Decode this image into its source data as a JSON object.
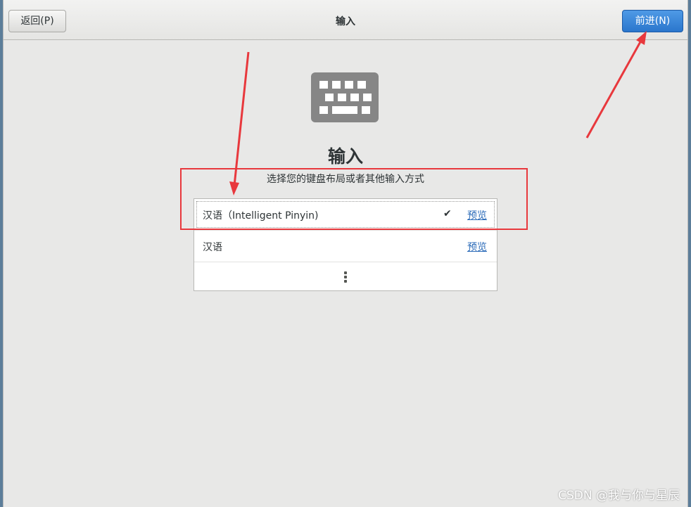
{
  "header": {
    "back_label": "返回(P)",
    "title": "输入",
    "next_label": "前进(N)"
  },
  "main": {
    "icon": "keyboard-icon",
    "title": "输入",
    "subtitle": "选择您的键盘布局或者其他输入方式",
    "sources": [
      {
        "label": "汉语（Intelligent Pinyin)",
        "selected": true,
        "preview_label": "预览"
      },
      {
        "label": "汉语",
        "selected": false,
        "preview_label": "预览"
      }
    ],
    "more_icon": "more-vertical-icon"
  },
  "watermark": "CSDN @我与你与星辰",
  "colors": {
    "accent": "#2a76cc",
    "annotation": "#e8383d",
    "link": "#2a6ab8"
  }
}
